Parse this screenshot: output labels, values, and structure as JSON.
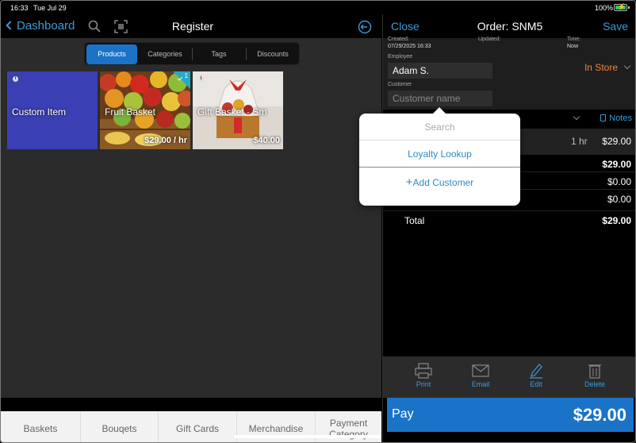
{
  "status_bar": {
    "time": "16:33",
    "date": "Tue Jul 29",
    "battery": "100%"
  },
  "register": {
    "back_label": "Dashboard",
    "title": "Register",
    "tabs": [
      "Products",
      "Categories",
      "Tags",
      "Discounts"
    ],
    "active_tab": "Products",
    "products": [
      {
        "name": "Custom Item",
        "price": ""
      },
      {
        "name": "Fruit Basket",
        "price": "$29.00 / hr",
        "badge": "1"
      },
      {
        "name": "Gift Basket - Sm",
        "price": "$40.00"
      }
    ],
    "categories": [
      "Baskets",
      "Bouqets",
      "Gift Cards",
      "Merchandise",
      "Payment\nCategory"
    ]
  },
  "order": {
    "close_label": "Close",
    "title": "Order: SNM5",
    "save_label": "Save",
    "created_label": "Created:",
    "created_value": "07/29/2025 16:33",
    "updated_label": "Updated:",
    "time_label": "Time:",
    "time_value": "Now",
    "employee_label": "Employee",
    "employee_value": "Adam S.",
    "customer_label": "Customer",
    "customer_placeholder": "Customer name",
    "location": "In Store",
    "notes_label": "Notes",
    "line_item": {
      "qty": "1 hr",
      "amount": "$29.00"
    },
    "subtotal": "$29.00",
    "row2": "$0.00",
    "row3": "$0.00",
    "total_label": "Total",
    "total_value": "$29.00",
    "actions": [
      "Print",
      "Email",
      "Edit",
      "Delete"
    ],
    "pay_label": "Pay",
    "pay_amount": "$29.00"
  },
  "customer_popover": {
    "search_placeholder": "Search",
    "loyalty_label": "Loyalty Lookup",
    "add_label": "Add Customer"
  },
  "colors": {
    "accent": "#1a73c7",
    "link": "#3a9bdc",
    "location": "#f0883a",
    "tile_custom": "#3b3fb4"
  }
}
